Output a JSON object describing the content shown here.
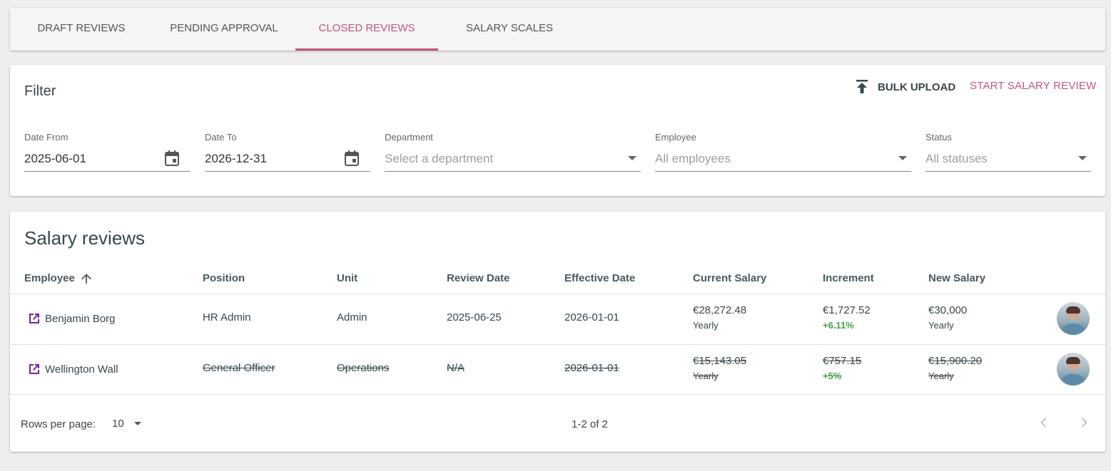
{
  "tabs": [
    {
      "label": "DRAFT REVIEWS"
    },
    {
      "label": "PENDING APPROVAL"
    },
    {
      "label": "CLOSED REVIEWS",
      "active": true
    },
    {
      "label": "SALARY SCALES"
    }
  ],
  "filter": {
    "title": "Filter",
    "bulk_upload_label": "BULK UPLOAD",
    "start_review_label": "START SALARY REVIEW",
    "date_from": {
      "label": "Date From",
      "value": "2025-06-01"
    },
    "date_to": {
      "label": "Date To",
      "value": "2026-12-31"
    },
    "department": {
      "label": "Department",
      "placeholder": "Select a department"
    },
    "employee": {
      "label": "Employee",
      "placeholder": "All employees"
    },
    "status": {
      "label": "Status",
      "placeholder": "All statuses"
    }
  },
  "reviews": {
    "title": "Salary reviews",
    "columns": [
      "Employee",
      "Position",
      "Unit",
      "Review Date",
      "Effective Date",
      "Current Salary",
      "Increment",
      "New Salary"
    ],
    "rows": [
      {
        "employee": "Benjamin Borg",
        "position": "HR Admin",
        "unit": "Admin",
        "review_date": "2025-06-25",
        "effective_date": "2026-01-01",
        "current_salary": "€28,272.48",
        "current_period": "Yearly",
        "increment": "€1,727.52",
        "increment_pct": "+6.11%",
        "new_salary": "€30,000",
        "new_period": "Yearly",
        "cancelled": false
      },
      {
        "employee": "Wellington Wall",
        "position": "General Officer",
        "unit": "Operations",
        "review_date": "N/A",
        "effective_date": "2026-01-01",
        "current_salary": "€15,143.05",
        "current_period": "Yearly",
        "increment": "€757.15",
        "increment_pct": "+5%",
        "new_salary": "€15,900.20",
        "new_period": "Yearly",
        "cancelled": true
      }
    ]
  },
  "pagination": {
    "rows_per_page_label": "Rows per page:",
    "rows_per_page": "10",
    "range": "1-2 of 2"
  },
  "colors": {
    "accent": "#c0587a",
    "positive": "#43a047",
    "link_icon": "#7b1fa2"
  }
}
